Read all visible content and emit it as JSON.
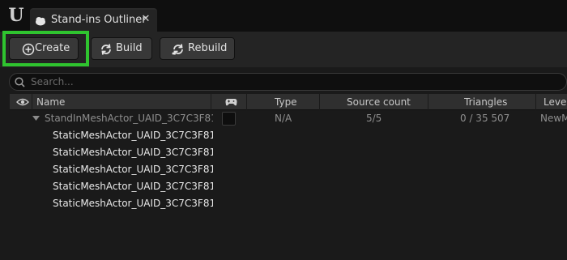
{
  "tab": {
    "title": "Stand-ins Outliner",
    "close_glyph": "✕"
  },
  "logo": {
    "glyph": "U",
    "icon": "unreal-engine-logo"
  },
  "toolbar": {
    "create_label": "Create",
    "build_label": "Build",
    "rebuild_label": "Rebuild",
    "highlight_color": "#2fc42f"
  },
  "search": {
    "placeholder": "Search...",
    "value": ""
  },
  "columns": {
    "visibility_icon": "eye-icon",
    "name": "Name",
    "game_icon": "gamepad-icon",
    "type": "Type",
    "source_count": "Source count",
    "triangles": "Triangles",
    "level": "Leve"
  },
  "rows": {
    "parent": {
      "name": "StandInMeshActor_UAID_3C7C3F81",
      "type": "N/A",
      "source_count": "5/5",
      "triangles": "0 / 35 507",
      "level": "NewM"
    },
    "children": [
      {
        "name": "StaticMeshActor_UAID_3C7C3F81"
      },
      {
        "name": "StaticMeshActor_UAID_3C7C3F81"
      },
      {
        "name": "StaticMeshActor_UAID_3C7C3F81"
      },
      {
        "name": "StaticMeshActor_UAID_3C7C3F81"
      },
      {
        "name": "StaticMeshActor_UAID_3C7C3F81"
      }
    ]
  }
}
